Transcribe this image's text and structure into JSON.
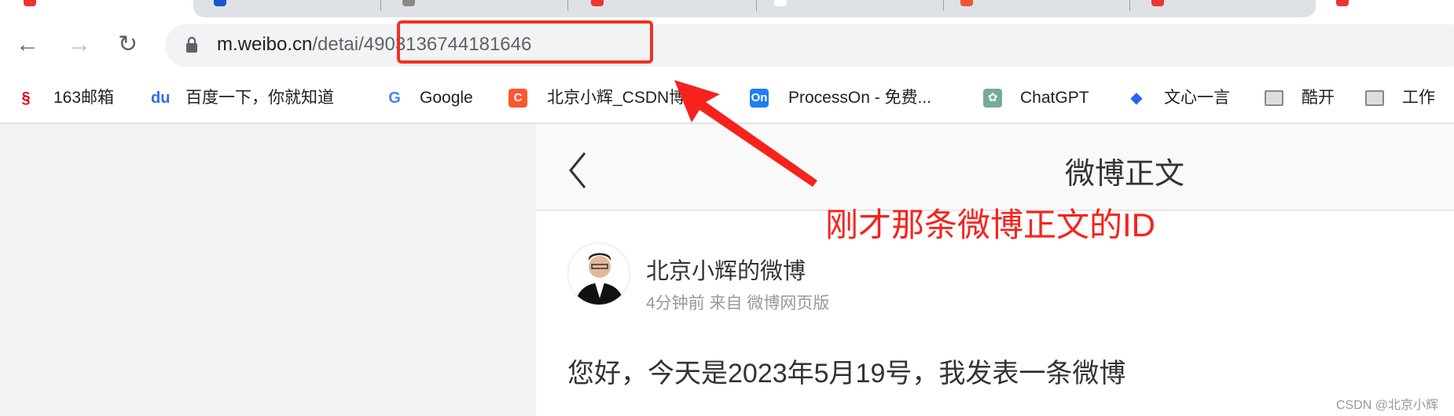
{
  "browser": {
    "nav": {
      "back": "←",
      "forward": "→",
      "reload": "↻"
    },
    "url": {
      "host": "m.weibo.cn",
      "path_prefix": "/detai",
      "id": "/4903136744181646"
    },
    "bookmarks": [
      {
        "label": "163邮箱",
        "icon": "163-mail-icon",
        "color": "#e60012",
        "glyph": "§"
      },
      {
        "label": "百度一下，你就知道",
        "icon": "baidu-paw-icon",
        "color": "#2f6bea",
        "glyph": "du"
      },
      {
        "label": "Google",
        "icon": "google-g-icon",
        "color": "#4285f4",
        "glyph": "G"
      },
      {
        "label": "北京小辉_CSDN博客",
        "icon": "csdn-icon",
        "color": "#fc5531",
        "glyph": "C"
      },
      {
        "label": "ProcessOn - 免费...",
        "icon": "processon-icon",
        "color": "#1e7ef2",
        "glyph": "On"
      },
      {
        "label": "ChatGPT",
        "icon": "chatgpt-icon",
        "color": "#74aa9c",
        "glyph": "✿"
      },
      {
        "label": "文心一言",
        "icon": "wenxin-icon",
        "color": "#2a62f0",
        "glyph": "◆"
      },
      {
        "label": "酷开",
        "icon": "folder-icon",
        "color": "#888888",
        "glyph": ""
      },
      {
        "label": "工作",
        "icon": "folder-icon",
        "color": "#888888",
        "glyph": ""
      }
    ]
  },
  "page": {
    "back": "〈",
    "title": "微博正文",
    "author": "北京小辉的微博",
    "meta": "4分钟前 来自 微博网页版",
    "body": "您好，今天是2023年5月19号，我发表一条微博"
  },
  "annotation": {
    "text": "刚才那条微博正文的ID",
    "color": "#f5231c"
  },
  "watermark": "CSDN @北京小辉"
}
